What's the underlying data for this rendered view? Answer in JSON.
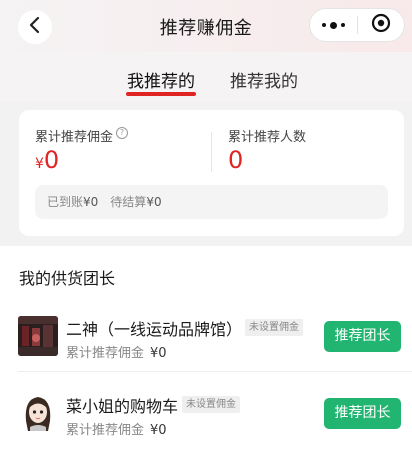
{
  "nav": {
    "title": "推荐赚佣金",
    "back_icon": "chevron-left-icon",
    "more_icon": "more-dots-icon",
    "close_icon": "target-close-icon"
  },
  "tabs": [
    {
      "label": "我推荐的",
      "active": true
    },
    {
      "label": "推荐我的",
      "active": false
    }
  ],
  "summary": {
    "commission_label": "累计推荐佣金",
    "commission_currency": "¥",
    "commission_value": "0",
    "people_label": "累计推荐人数",
    "people_value": "0",
    "arrived_label": "已到账",
    "arrived_value": "¥0",
    "pending_label": "待结算",
    "pending_value": "¥0"
  },
  "section": {
    "title": "我的供货团长"
  },
  "leaders": [
    {
      "name": "二神（一线运动品牌馆）",
      "tag": "未设置佣金",
      "sub_label": "累计推荐佣金",
      "sub_value": "¥0",
      "button": "推荐团长"
    },
    {
      "name": "菜小姐的购物车",
      "tag": "未设置佣金",
      "sub_label": "累计推荐佣金",
      "sub_value": "¥0",
      "button": "推荐团长"
    }
  ],
  "colors": {
    "accent_red": "#e02424",
    "button_green": "#21b571"
  }
}
